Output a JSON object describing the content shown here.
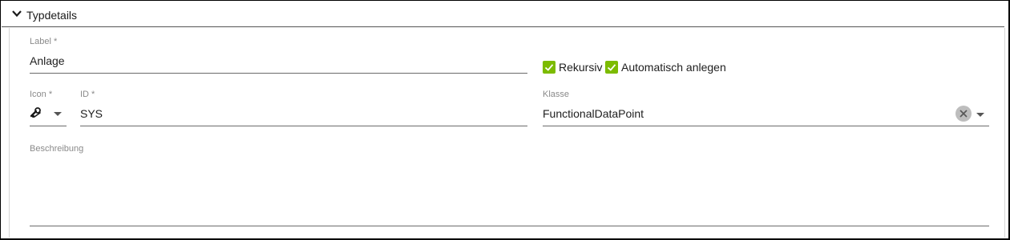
{
  "section": {
    "title": "Typdetails",
    "expanded": true
  },
  "fields": {
    "label": {
      "label": "Label *",
      "value": "Anlage"
    },
    "icon": {
      "label": "Icon *",
      "icon_name": "wrench-key-icon"
    },
    "id": {
      "label": "ID *",
      "value": "SYS"
    },
    "klasse": {
      "label": "Klasse",
      "value": "FunctionalDataPoint"
    },
    "beschreibung": {
      "label": "Beschreibung",
      "value": ""
    }
  },
  "checkboxes": [
    {
      "label": "Rekursiv",
      "checked": true
    },
    {
      "label": "Automatisch anlegen",
      "checked": true
    }
  ],
  "colors": {
    "accent": "#7cbb00",
    "underline": "#6b6b6b",
    "label_grey": "#8a8a8a"
  }
}
